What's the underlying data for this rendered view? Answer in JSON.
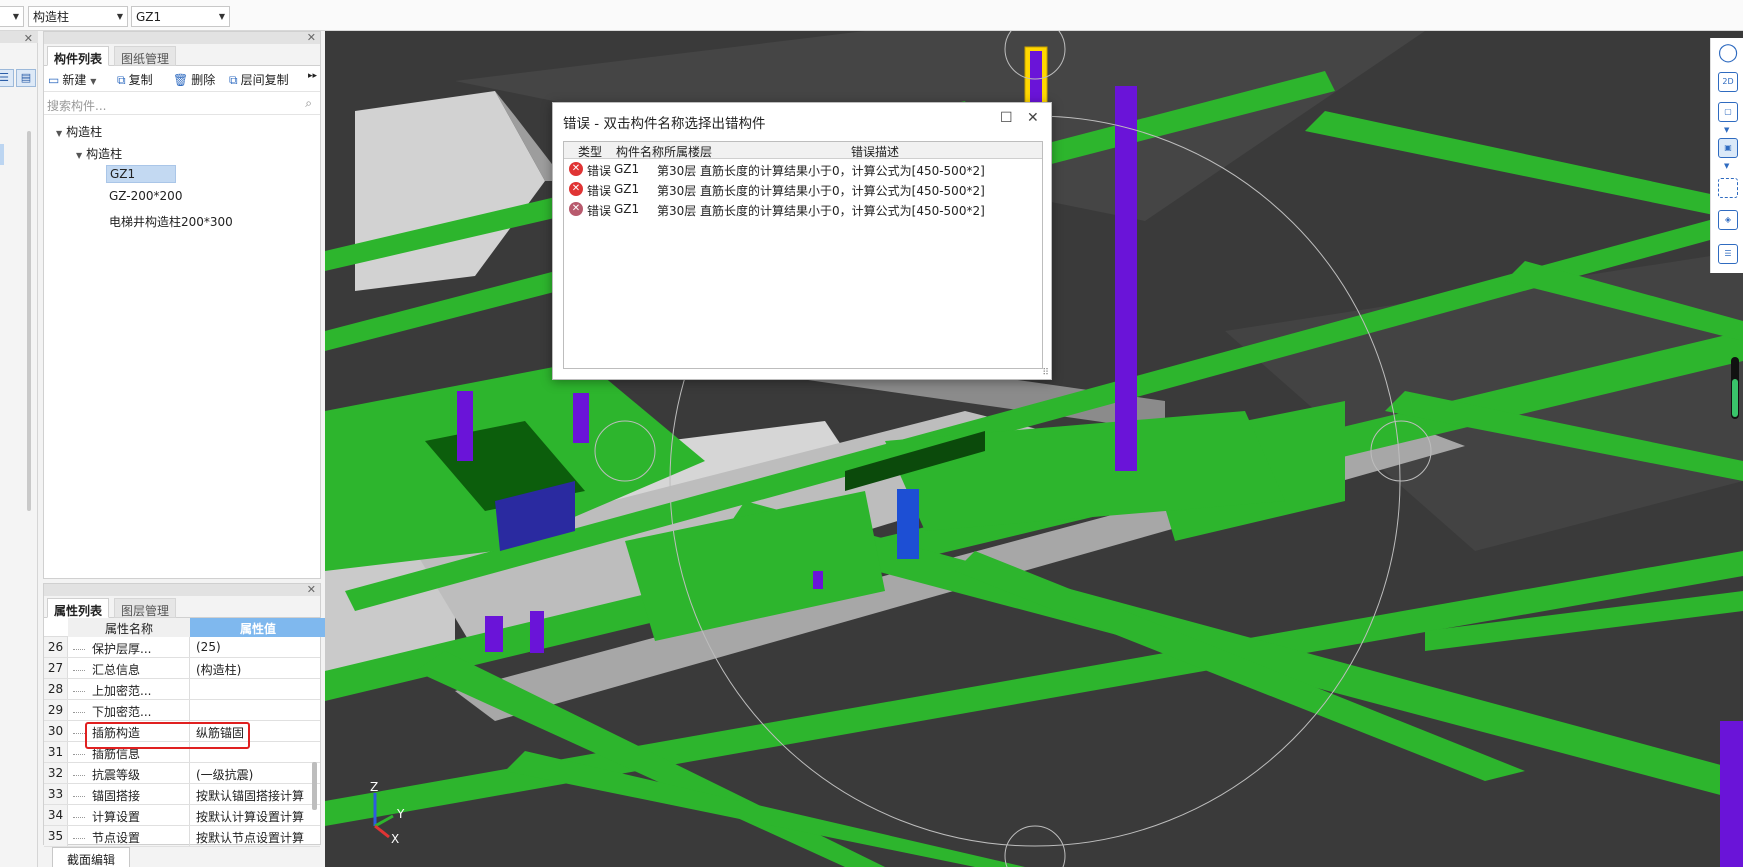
{
  "topbar": {
    "combo_category": "构造柱",
    "combo_component": "GZ1"
  },
  "component_panel": {
    "tabs": [
      "构件列表",
      "图纸管理"
    ],
    "tools": {
      "new": "新建",
      "copy": "复制",
      "delete": "删除",
      "floor_copy": "层间复制"
    },
    "search_placeholder": "搜索构件...",
    "tree": {
      "root": "构造柱",
      "group": "构造柱",
      "items": [
        "GZ1",
        "GZ-200*200",
        "电梯井构造柱200*300"
      ],
      "selected": "GZ1"
    }
  },
  "property_panel": {
    "tabs": [
      "属性列表",
      "图层管理"
    ],
    "header": {
      "name": "属性名称",
      "value": "属性值"
    },
    "rows": [
      {
        "num": "26",
        "name": "保护层厚...",
        "value": "(25)"
      },
      {
        "num": "27",
        "name": "汇总信息",
        "value": "(构造柱)"
      },
      {
        "num": "28",
        "name": "上加密范...",
        "value": ""
      },
      {
        "num": "29",
        "name": "下加密范...",
        "value": ""
      },
      {
        "num": "30",
        "name": "插筋构造",
        "value": "纵筋锚固"
      },
      {
        "num": "31",
        "name": "插筋信息",
        "value": ""
      },
      {
        "num": "32",
        "name": "抗震等级",
        "value": "(一级抗震)"
      },
      {
        "num": "33",
        "name": "锚固搭接",
        "value": "按默认锚固搭接计算"
      },
      {
        "num": "34",
        "name": "计算设置",
        "value": "按默认计算设置计算"
      },
      {
        "num": "35",
        "name": "节点设置",
        "value": "按默认节点设置计算"
      }
    ],
    "highlighted_row": "30",
    "bottom_tab": "截面编辑"
  },
  "error_dialog": {
    "title": "错误 - 双击构件名称选择出错构件",
    "columns": [
      "类型",
      "构件名称",
      "所属楼层",
      "错误描述"
    ],
    "rows": [
      {
        "type": "错误",
        "name": "GZ1",
        "floor": "第30层",
        "desc": "直筋长度的计算结果小于0，计算公式为[450-500*2]"
      },
      {
        "type": "错误",
        "name": "GZ1",
        "floor": "第30层",
        "desc": "直筋长度的计算结果小于0，计算公式为[450-500*2]"
      },
      {
        "type": "错误",
        "name": "GZ1",
        "floor": "第30层",
        "desc": "直筋长度的计算结果小于0，计算公式为[450-500*2]"
      }
    ]
  },
  "viewport": {
    "axis_labels": {
      "z": "Z",
      "y": "Y",
      "x": "X"
    },
    "right_toolbar": [
      "orbit-icon",
      "2d-view-icon",
      "3d-box-icon",
      "solid-box-icon",
      "fullscreen-icon",
      "layer-cube-icon",
      "display-settings-icon"
    ],
    "right_toolbar_2d_label": "2D"
  },
  "colors": {
    "beam_green": "#2db52d",
    "column_purple": "#6a14d8",
    "slab_dark": "#3a3a3a",
    "wall_grey": "#cfcfcf",
    "accent_blue": "#7fb8ee",
    "error_red": "#e03434"
  }
}
